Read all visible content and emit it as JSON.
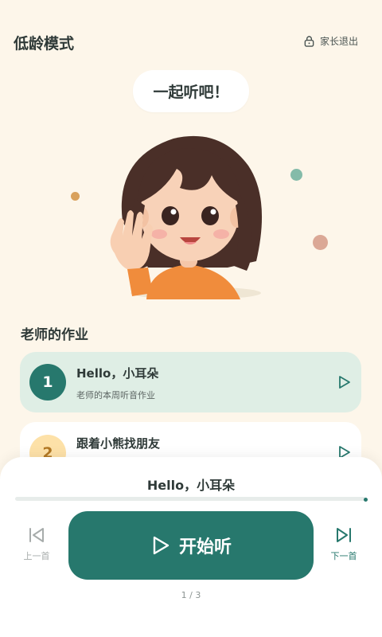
{
  "header": {
    "title": "低龄模式",
    "parent_exit_label": "家长退出"
  },
  "hero": {
    "bubble_text": "一起听吧！"
  },
  "tasks_section": {
    "title": "老师的作业",
    "items": [
      {
        "number": "1",
        "name": "Hello，小耳朵",
        "subtitle": "老师的本周听音作业"
      },
      {
        "number": "2",
        "name": "跟着小熊找朋友",
        "subtitle": ""
      }
    ]
  },
  "player": {
    "now_playing": "Hello，小耳朵",
    "prev_label": "上一首",
    "start_label": "开始听",
    "next_label": "下一首",
    "page_indicator": "1 / 3",
    "progress": 1.0
  },
  "colors": {
    "background": "#fdf6ea",
    "accent": "#27786d",
    "active_card": "#dfeee5"
  },
  "icons": [
    "lock-icon",
    "play-icon",
    "skip-previous-icon",
    "skip-next-icon"
  ]
}
